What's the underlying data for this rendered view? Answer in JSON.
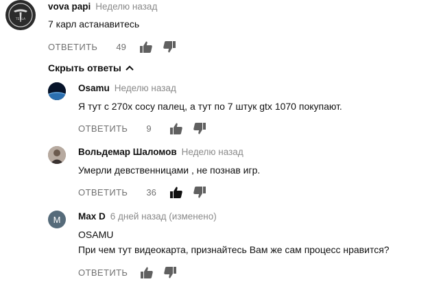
{
  "comment": {
    "author": "vova papi",
    "time": "Неделю назад",
    "text": "7 карл астанавитесь",
    "reply_label": "ОТВЕТИТЬ",
    "likes": "49",
    "avatar_text": "TESLA"
  },
  "toggle_label": "Скрыть ответы",
  "replies": [
    {
      "author": "Osamu",
      "time": "Неделю назад",
      "text": "Я тут с 270х сосу палец, а тут по 7 штук gtx 1070 покупают.",
      "reply_label": "ОТВЕТИТЬ",
      "likes": "9"
    },
    {
      "author": "Вольдемар Шаломов",
      "time": "Неделю назад",
      "text": "Умерли девственницами , не познав игр.",
      "reply_label": "ОТВЕТИТЬ",
      "likes": "36"
    },
    {
      "author": "Max D",
      "time": "6 дней назад (изменено)",
      "text_line1": "OSAMU",
      "text_line2": "При чем тут видеокарта, признайтесь Вам же сам процесс нравится?",
      "reply_label": "ОТВЕТИТЬ",
      "avatar_letter": "M"
    }
  ]
}
